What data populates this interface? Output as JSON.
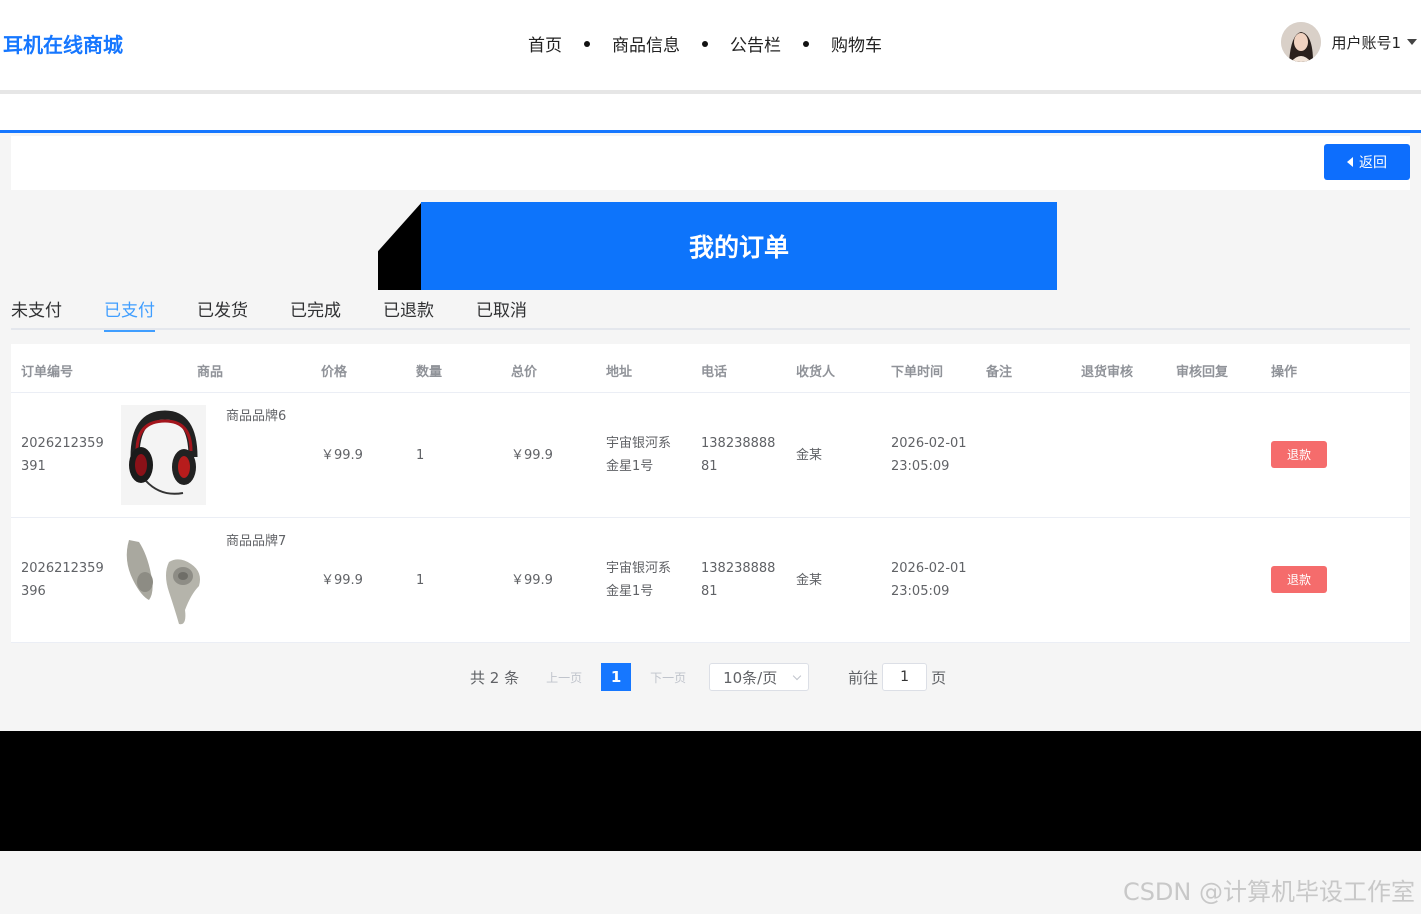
{
  "header": {
    "brand": "耳机在线商城",
    "nav": [
      "首页",
      "商品信息",
      "公告栏",
      "购物车"
    ],
    "user_name": "用户账号1"
  },
  "toolbar": {
    "back_label": "返回"
  },
  "page_title": "我的订单",
  "tabs": [
    {
      "label": "未支付",
      "active": false
    },
    {
      "label": "已支付",
      "active": true
    },
    {
      "label": "已发货",
      "active": false
    },
    {
      "label": "已完成",
      "active": false
    },
    {
      "label": "已退款",
      "active": false
    },
    {
      "label": "已取消",
      "active": false
    }
  ],
  "table": {
    "columns": [
      "订单编号",
      "商品",
      "价格",
      "数量",
      "总价",
      "地址",
      "电话",
      "收货人",
      "下单时间",
      "备注",
      "退货审核",
      "审核回复",
      "操作"
    ],
    "rows": [
      {
        "order_no_1": "2026212359",
        "order_no_2": "391",
        "product_name": "商品品牌6",
        "product_image": "headphones-icon",
        "price": "￥99.9",
        "qty": "1",
        "total": "￥99.9",
        "addr_1": "宇宙银河系",
        "addr_2": "金星1号",
        "phone_1": "138238888",
        "phone_2": "81",
        "receiver": "金某",
        "time_1": "2026-02-01",
        "time_2": "23:05:09",
        "action": "退款"
      },
      {
        "order_no_1": "2026212359",
        "order_no_2": "396",
        "product_name": "商品品牌7",
        "product_image": "earbuds-icon",
        "price": "￥99.9",
        "qty": "1",
        "total": "￥99.9",
        "addr_1": "宇宙银河系",
        "addr_2": "金星1号",
        "phone_1": "138238888",
        "phone_2": "81",
        "receiver": "金某",
        "time_1": "2026-02-01",
        "time_2": "23:05:09",
        "action": "退款"
      }
    ]
  },
  "pagination": {
    "total": "共 2 条",
    "prev": "上一页",
    "current": "1",
    "next": "下一页",
    "page_size": "10条/页",
    "goto_label": "前往",
    "goto_value": "1",
    "page_suffix": "页"
  },
  "watermark": "CSDN @计算机毕设工作室",
  "colors": {
    "accent": "#1677ff",
    "danger": "#f56c6c"
  }
}
